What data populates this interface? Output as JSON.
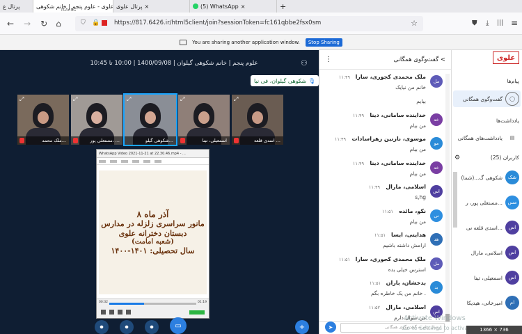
{
  "browser": {
    "tabs": [
      {
        "label": "پرتال ع",
        "closable": true
      },
      {
        "label": "علوی - علوم پنجم | خانم شکوهی ...",
        "sub": "PLAYING",
        "closable": true
      },
      {
        "label": "پرتال علوی",
        "closable": true
      },
      {
        "label": "(5) WhatsApp",
        "closable": true
      }
    ],
    "new_tab": "+",
    "url": "https://817.6426.ir/html5client/join?sessionToken=fc161qbbe2fsx0sm",
    "controls": {
      "back": "←",
      "forward": "→",
      "reload": "↻",
      "home": "⌂",
      "menu": "≡",
      "library": "|||",
      "star": "☆"
    }
  },
  "share_bar": {
    "text": "You are sharing another application window.",
    "stop_label": "Stop Sharing"
  },
  "meeting": {
    "title": "علوم پنجم | خانم شکوهی گیلوان | 1400/09/08 | 10:00 تا 10:45",
    "speaker": "شکوهی گیلوان، فی نبا"
  },
  "thumbnails": [
    {
      "name": "ملک محمد...",
      "skin": "#c99a84",
      "bg": "#7a6a5c"
    },
    {
      "name": "مستعلی پور، ...",
      "skin": "#d9b0a0",
      "bg": "#a09a96"
    },
    {
      "name": "شکوهی گیلو...",
      "skin": "#d3a692",
      "bg": "#8a8e96",
      "selected": true
    },
    {
      "name": "اسمعیلی، تینا",
      "skin": "#caa08c",
      "bg": "#8f7f78"
    },
    {
      "name": "اسدی قلعه ...",
      "skin": "#c89a86",
      "bg": "#6a5c52"
    }
  ],
  "shared_window": {
    "title": "WhatsApp Video 2021-11-21 at 22.30.46.mp4 - ...",
    "poster_lines": [
      "۸ آذر ماه",
      "مانور سراسری زلزله در مدارس",
      "دبستان دخترانه علوی",
      "(شعبه امامت)",
      "سال تحصیلی: ۱۴۰۱-۱۴۰۰"
    ],
    "time_elapsed": "00:32",
    "time_total": "01:19",
    "progress": 0.4
  },
  "chat": {
    "title": "گفت‌وگوی همگانی",
    "messages": [
      {
        "name": "ملک محمدی کجوری، سارا",
        "time": "۱۱:۴۹",
        "text": "خانم من نیایک",
        "avatar": "مل",
        "color": "#5e5bb8"
      },
      {
        "name": "",
        "time": "",
        "text": "بیایم",
        "avatar": "",
        "color": ""
      },
      {
        "name": "خداینده سامانی، دینا",
        "time": "۱۱:۴۹",
        "text": "من بیام",
        "avatar": "خد",
        "color": "#7a3ea3"
      },
      {
        "name": "موسوی، نازنین زهراسادات",
        "time": "۱۱:۴۹",
        "text": "من بیام",
        "avatar": "مو",
        "color": "#2a8bd8"
      },
      {
        "name": "خداینده سامانی، دینا",
        "time": "۱۱:۴۹",
        "text": "من بیام",
        "avatar": "خد",
        "color": "#7a3ea3"
      },
      {
        "name": "اسلامی، مارال",
        "time": "۱۱:۴۹",
        "text": "s,hg",
        "avatar": "اس",
        "color": "#4f3fa0"
      },
      {
        "name": "نکو، مائده",
        "time": "۱۱:۵۱",
        "text": "من بیام",
        "avatar": "نی",
        "color": "#2e8fe0"
      },
      {
        "name": "هدایتی، ایسا",
        "time": "۱۱:۵۱",
        "text": "ارامش داشته باشیم",
        "avatar": "هد",
        "color": "#2f6fb6"
      },
      {
        "name": "ملک محمدی کجوری، سارا",
        "time": "۱۱:۵۱",
        "text": "استرس خیلی بده",
        "avatar": "مل",
        "color": "#5e5bb8"
      },
      {
        "name": "بدخشان، باران",
        "time": "۱۱:۵۱",
        "text": "خانم من یک خاطره بگم .",
        "avatar": "بد",
        "color": "#2a8bd8"
      },
      {
        "name": "اسلامی، مارال",
        "time": "۱۱:۵۲",
        "text": "من سوال دارم",
        "avatar": "اس",
        "color": "#4f3fa0"
      }
    ],
    "input_placeholder": "ارسال پیام به گفت‌وگوی همگانی"
  },
  "sidebar": {
    "logo": "علوی",
    "messages_header": "پیام‌ها",
    "public_chat": "گفت‌وگوی همگانی",
    "notes_header": "یادداشت‌ها",
    "shared_notes": "یادداشت‌های همگانی",
    "users_header": "کاربران (25)",
    "users": [
      {
        "name": "شکوهی گ...(شما)",
        "avatar": "شک",
        "color": "#2a8bd8"
      },
      {
        "name": "مستعلی پور، ر...",
        "avatar": "مس",
        "color": "#2e8fe0"
      },
      {
        "name": "اسدی قلعه نی...",
        "avatar": "اس",
        "color": "#4f3fa0"
      },
      {
        "name": "اسلامی، مارال",
        "avatar": "اس",
        "color": "#4f3fa0"
      },
      {
        "name": "اسمعیلی، تینا",
        "avatar": "اس",
        "color": "#4f3fa0"
      },
      {
        "name": "امیرخانی، هیدیکا",
        "avatar": "ام",
        "color": "#2f6fb6"
      }
    ]
  },
  "os": {
    "activate": "Activate Windows",
    "activate_sub": "Go to Settings to activate",
    "resolution": "1366 × 736"
  }
}
